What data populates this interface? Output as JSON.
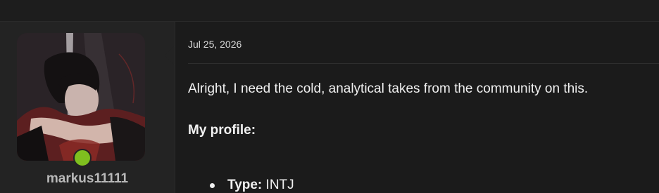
{
  "post": {
    "date": "Jul 25, 2026",
    "body_line": "Alright, I need the cold, analytical takes from the community on this.",
    "heading": "My profile:",
    "list_items": [
      {
        "key": "Type:",
        "value": "INTJ"
      }
    ]
  },
  "user": {
    "username": "markus11111",
    "online": true
  },
  "colors": {
    "online_dot": "#7fbf1f",
    "background": "#1b1b1b",
    "user_panel": "#232323"
  }
}
